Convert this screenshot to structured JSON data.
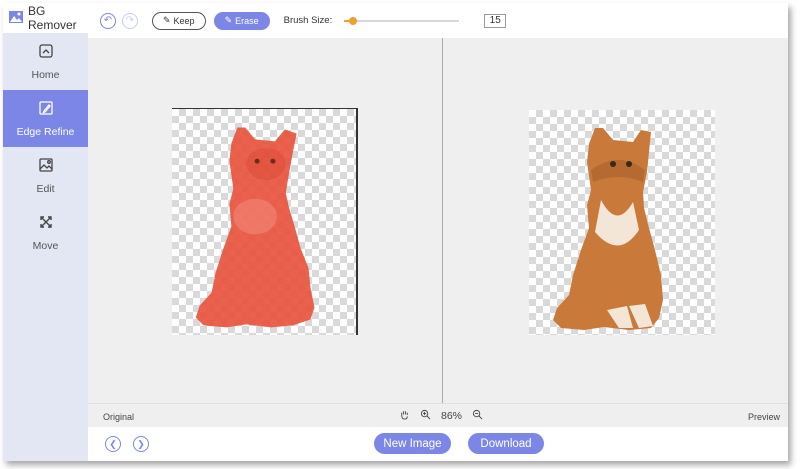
{
  "app": {
    "title": "BG Remover",
    "logo_icon": "bg-remover-logo-icon"
  },
  "sidebar": {
    "items": [
      {
        "label": "Home",
        "icon": "home-icon",
        "active": false
      },
      {
        "label": "Edge Refine",
        "icon": "edge-refine-icon",
        "active": true
      },
      {
        "label": "Edit",
        "icon": "edit-icon",
        "active": false
      },
      {
        "label": "Move",
        "icon": "move-icon",
        "active": false
      }
    ]
  },
  "toolbar": {
    "undo_icon": "undo-icon",
    "redo_icon": "redo-icon",
    "keep_label": "Keep",
    "erase_label": "Erase",
    "brush_size_label": "Brush Size:",
    "brush_size_value": "15",
    "brush_slider_fraction": 0.08
  },
  "canvas": {
    "left_label": "Original",
    "right_label": "Preview",
    "zoom_value": "86%"
  },
  "footer": {
    "new_image_label": "New Image",
    "download_label": "Download"
  },
  "colors": {
    "accent": "#7c86e6",
    "sidebar_bg": "#e3e7f4",
    "slider": "#f0a030",
    "selection_overlay": "#e8553f"
  }
}
